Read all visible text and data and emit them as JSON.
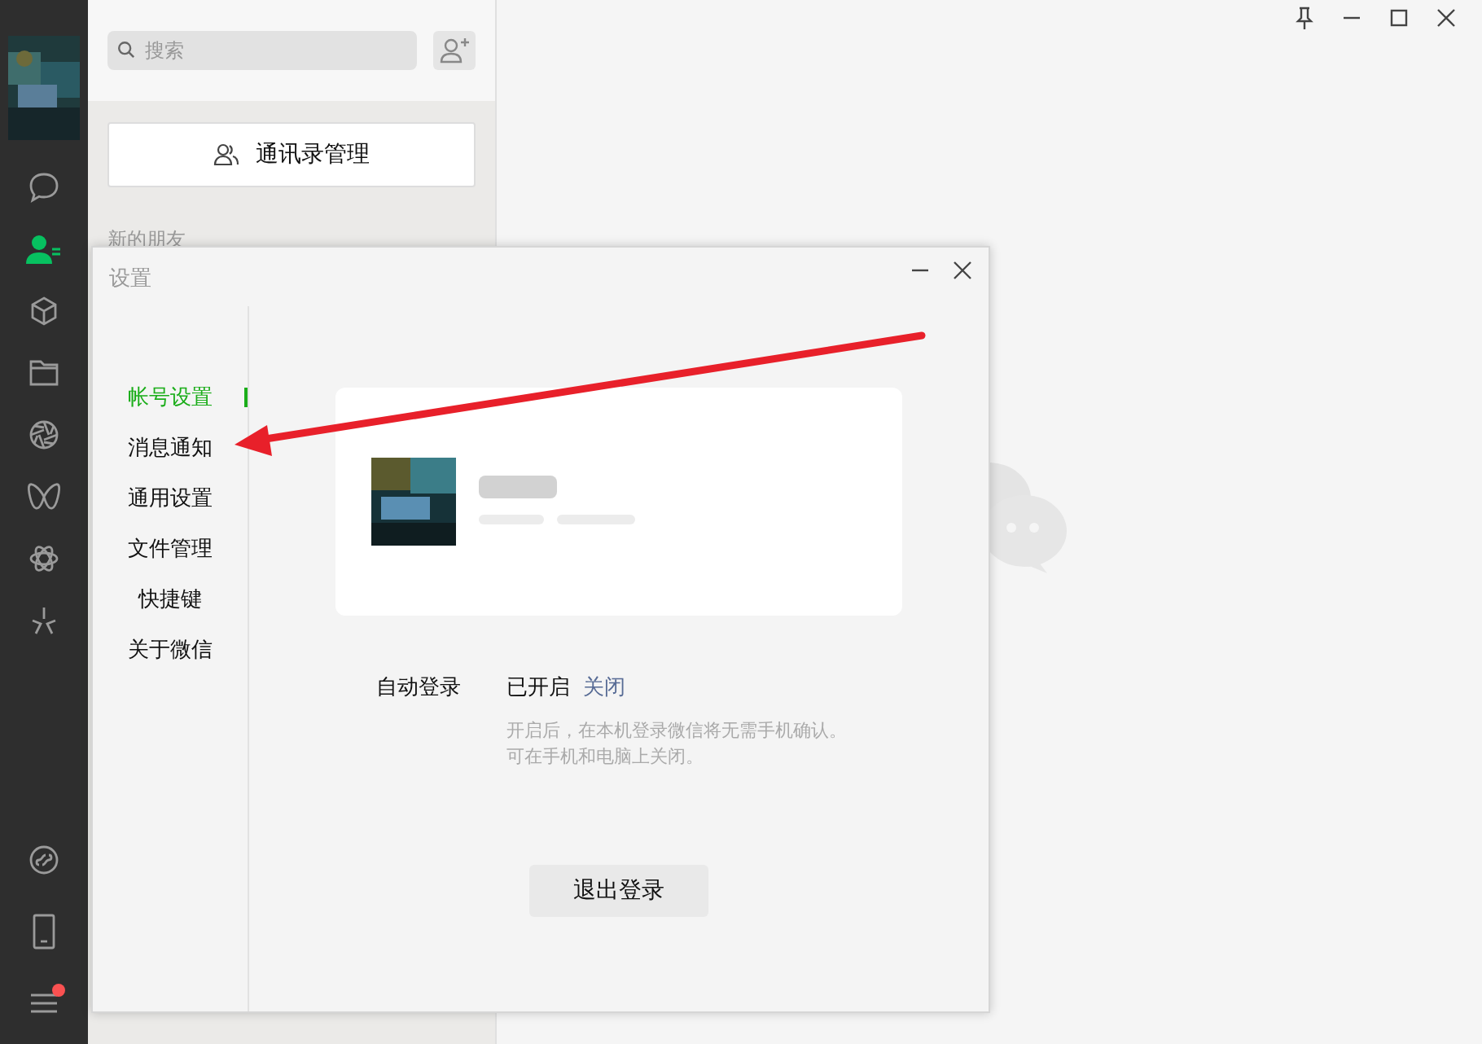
{
  "sidebar": {
    "nav_icons": [
      {
        "kind": "chat",
        "selected": false
      },
      {
        "kind": "contacts",
        "selected": true
      },
      {
        "kind": "cube",
        "selected": false
      },
      {
        "kind": "folder",
        "selected": false
      },
      {
        "kind": "aperture",
        "selected": false
      },
      {
        "kind": "loop",
        "selected": false
      },
      {
        "kind": "atom",
        "selected": false
      },
      {
        "kind": "spark",
        "selected": false
      }
    ],
    "bottom_icons": [
      {
        "kind": "mini-program",
        "badge": false
      },
      {
        "kind": "phone",
        "badge": false
      },
      {
        "kind": "menu",
        "badge": true
      }
    ]
  },
  "contacts": {
    "search": {
      "placeholder": "搜索"
    },
    "manage_button": "通讯录管理",
    "section_label": "新的朋友"
  },
  "settings_dialog": {
    "title": "设置",
    "menu": [
      {
        "label": "帐号设置",
        "selected": true
      },
      {
        "label": "消息通知",
        "selected": false
      },
      {
        "label": "通用设置",
        "selected": false
      },
      {
        "label": "文件管理",
        "selected": false
      },
      {
        "label": "快捷键",
        "selected": false
      },
      {
        "label": "关于微信",
        "selected": false
      }
    ],
    "auto_login": {
      "label": "自动登录",
      "status": "已开启",
      "action": "关闭",
      "hint_lines": [
        "开启后，在本机登录微信将无需手机确认。",
        "可在手机和电脑上关闭。"
      ]
    },
    "logout_button": "退出登录"
  }
}
